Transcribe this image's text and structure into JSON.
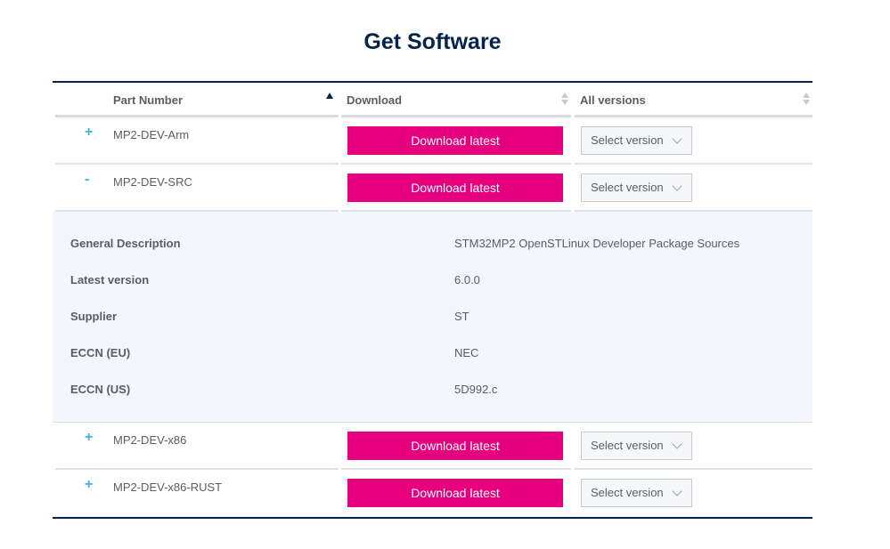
{
  "title": "Get Software",
  "table": {
    "headers": {
      "part_number": "Part Number",
      "download": "Download",
      "all_versions": "All versions"
    },
    "rows_before_detail": [
      {
        "toggle": "+",
        "part": "MP2-DEV-Arm",
        "download_label": "Download latest",
        "select_label": "Select version"
      },
      {
        "toggle": "-",
        "part": "MP2-DEV-SRC",
        "download_label": "Download latest",
        "select_label": "Select version"
      }
    ],
    "detail": [
      {
        "label": "General Description",
        "value": "STM32MP2 OpenSTLinux Developer Package Sources"
      },
      {
        "label": "Latest version",
        "value": "6.0.0"
      },
      {
        "label": "Supplier",
        "value": "ST"
      },
      {
        "label": "ECCN (EU)",
        "value": "NEC"
      },
      {
        "label": "ECCN (US)",
        "value": "5D992.c"
      }
    ],
    "rows_after_detail": [
      {
        "toggle": "+",
        "part": "MP2-DEV-x86",
        "download_label": "Download latest",
        "select_label": "Select version"
      },
      {
        "toggle": "+",
        "part": "MP2-DEV-x86-RUST",
        "download_label": "Download latest",
        "select_label": "Select version"
      }
    ]
  },
  "colors": {
    "title": "#03234b",
    "accent_button": "#e6007e",
    "toggle": "#3cb4e6",
    "detail_background": "#f3f6fa"
  }
}
